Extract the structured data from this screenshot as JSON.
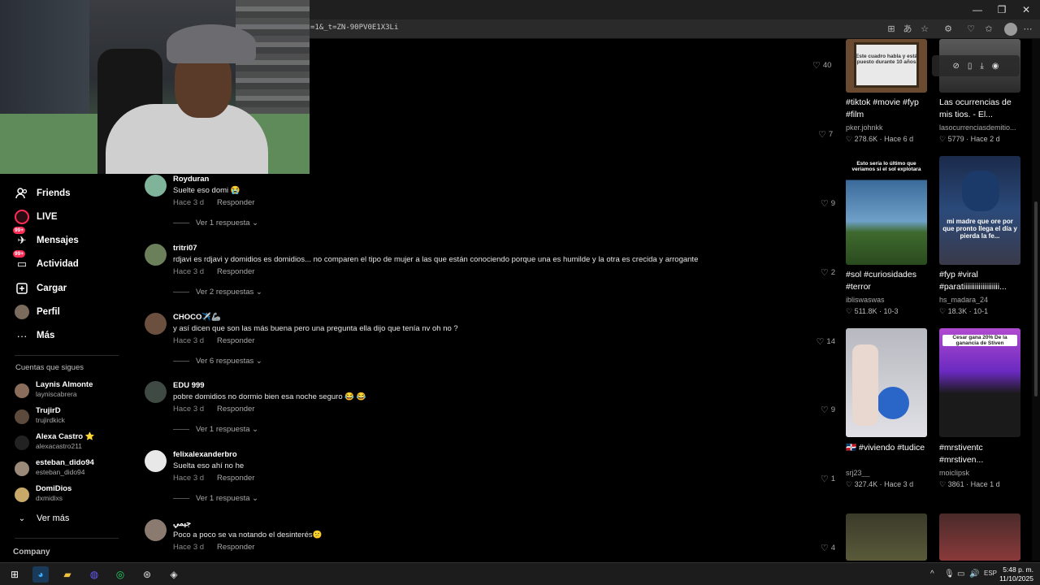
{
  "browser": {
    "url": "=1&_t=ZN-90PV0E1X3Li"
  },
  "sidebar": {
    "nav": [
      {
        "label": "Friends",
        "icon": "friends-icon"
      },
      {
        "label": "LIVE",
        "icon": "live-icon"
      },
      {
        "label": "Mensajes",
        "icon": "messages-icon",
        "badge": "99+"
      },
      {
        "label": "Actividad",
        "icon": "activity-icon",
        "badge": "99+"
      },
      {
        "label": "Cargar",
        "icon": "upload-icon"
      },
      {
        "label": "Perfil",
        "icon": "profile-avatar"
      },
      {
        "label": "Más",
        "icon": "more-icon"
      }
    ],
    "following_title": "Cuentas que sigues",
    "following": [
      {
        "name": "Laynis Almonte",
        "user": "layniscabrera"
      },
      {
        "name": "TrujirD",
        "user": "trujirdkick"
      },
      {
        "name": "Alexa Castro ⭐",
        "user": "alexacastro211"
      },
      {
        "name": "esteban_dido94",
        "user": "esteban_dido94"
      },
      {
        "name": "DomiDios",
        "user": "dxmidixs"
      }
    ],
    "see_more": "Ver más",
    "company": "Company"
  },
  "likes_top": [
    {
      "count": "40"
    },
    {
      "count": "7"
    }
  ],
  "comments": [
    {
      "user": "Royduran",
      "text": "Suelte eso domi 😭",
      "time": "Hace 3 d",
      "reply": "Responder",
      "more": "Ver 1 respuesta",
      "likes": "9"
    },
    {
      "user": "tritri07",
      "text": "rdjavi es rdjavi y domidios es domidios... no comparen el tipo de mujer a las que están conociendo porque una es humilde y la otra es crecida y arrogante",
      "time": "Hace 3 d",
      "reply": "Responder",
      "more": "Ver 2 respuestas",
      "likes": "2"
    },
    {
      "user": "CHOCO✈️🦾",
      "text": "y así dicen que son las más buena pero una pregunta ella dijo que tenía nv oh no ?",
      "time": "Hace 3 d",
      "reply": "Responder",
      "more": "Ver 6 respuestas",
      "likes": "14"
    },
    {
      "user": "EDU 999",
      "text": "pobre domidios no dormio bien esa noche seguro 😂 😂",
      "time": "Hace 3 d",
      "reply": "Responder",
      "more": "Ver 1 respuesta",
      "likes": "9"
    },
    {
      "user": "felixalexanderbro",
      "text": "Suelta eso ahí no he",
      "time": "Hace 3 d",
      "reply": "Responder",
      "more": "Ver 1 respuesta",
      "likes": "1"
    },
    {
      "user": "جيمي",
      "text": "Poco a poco se va notando el desinterés😕",
      "time": "Hace 3 d",
      "reply": "Responder",
      "more": "",
      "likes": "4"
    }
  ],
  "videos": [
    {
      "title": "#tiktok #movie #fyp #film",
      "user": "pker.johnkk",
      "views": "278.6K",
      "date": "Hace 6 d",
      "thumb_text": "Este cuadro habla y está puesto durante 10 años"
    },
    {
      "title": "Las ocurrencias de mis tios. - El...",
      "user": "lasocurrenciasdemitio...",
      "views": "5779",
      "date": "Hace 2 d",
      "thumb_text": ""
    },
    {
      "title": "#sol #curiosidades #terror",
      "user": "ibliswaswas",
      "views": "511.8K",
      "date": "10-3",
      "thumb_text": "Esto sería lo último que veríamos si el sol explotara"
    },
    {
      "title": "#fyp #viral #paratiiiiiiiiiiiiiiiiiii...",
      "user": "hs_madara_24",
      "views": "18.3K",
      "date": "10-1",
      "thumb_text": "mi madre que ore por que pronto llega el día y pierda la fe..."
    },
    {
      "title": "🇩🇴 #viviendo #tudice",
      "user": "srj23__",
      "views": "327.4K",
      "date": "Hace 3 d",
      "thumb_text": ""
    },
    {
      "title": "#mrstiventc #mrstiven...",
      "user": "moiclipsk",
      "views": "3861",
      "date": "Hace 1 d",
      "thumb_text": "Cesar gana 20% De la ganancia de Stiven"
    }
  ],
  "taskbar": {
    "lang": "ESP",
    "time": "5:48 p. m.",
    "date": "11/10/2025"
  },
  "colors": {
    "accent": "#fe2c55",
    "background": "#000000"
  }
}
